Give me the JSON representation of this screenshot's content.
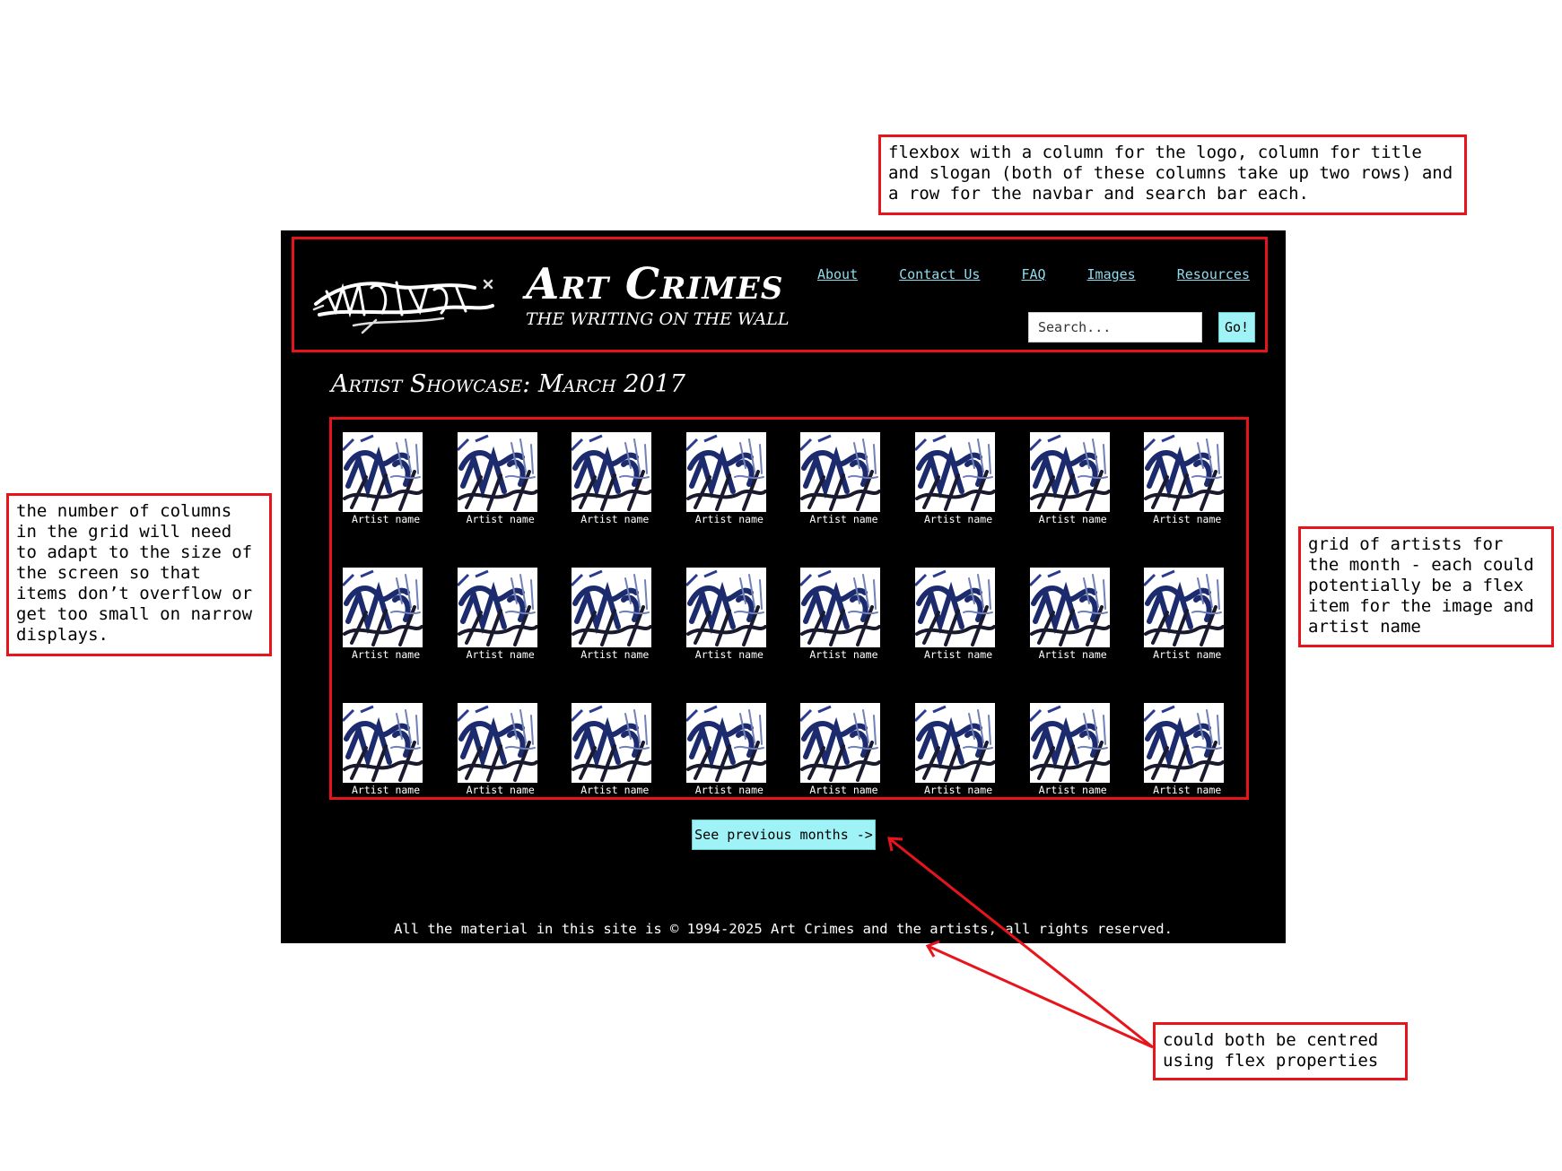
{
  "notes": {
    "header": "flexbox with a column for the logo, column for title and slogan (both of these columns take up two rows) and a row for the navbar and search bar each.",
    "grid_columns": "the number of columns in the grid will need to adapt to the size of the screen so that items don’t overflow or get too small on narrow displays.",
    "grid_artists": "grid of artists for the month - each could potentially be a flex item for the image and artist name",
    "centred": "could both be centred using flex properties"
  },
  "header": {
    "title": "Art Crimes",
    "slogan": "THE WRITING ON THE WALL",
    "logo_icon": "graffiti-tag-logo"
  },
  "nav": [
    "About",
    "Contact Us",
    "FAQ",
    "Images",
    "Resources"
  ],
  "search": {
    "placeholder": "Search...",
    "button": "Go!"
  },
  "showcase": {
    "title": "Artist Showcase: March 2017",
    "artists": [
      "Artist name",
      "Artist name",
      "Artist name",
      "Artist name",
      "Artist name",
      "Artist name",
      "Artist name",
      "Artist name",
      "Artist name",
      "Artist name",
      "Artist name",
      "Artist name",
      "Artist name",
      "Artist name",
      "Artist name",
      "Artist name",
      "Artist name",
      "Artist name",
      "Artist name",
      "Artist name",
      "Artist name",
      "Artist name",
      "Artist name",
      "Artist name"
    ]
  },
  "previous_button": "See previous months ->",
  "footer": "All the material in this site is © 1994-2025 Art Crimes and the artists, all rights reserved.",
  "colors": {
    "accent": "#9ff3f7",
    "link": "#8fdcef",
    "annotation": "#e8141c",
    "background": "#000000"
  }
}
